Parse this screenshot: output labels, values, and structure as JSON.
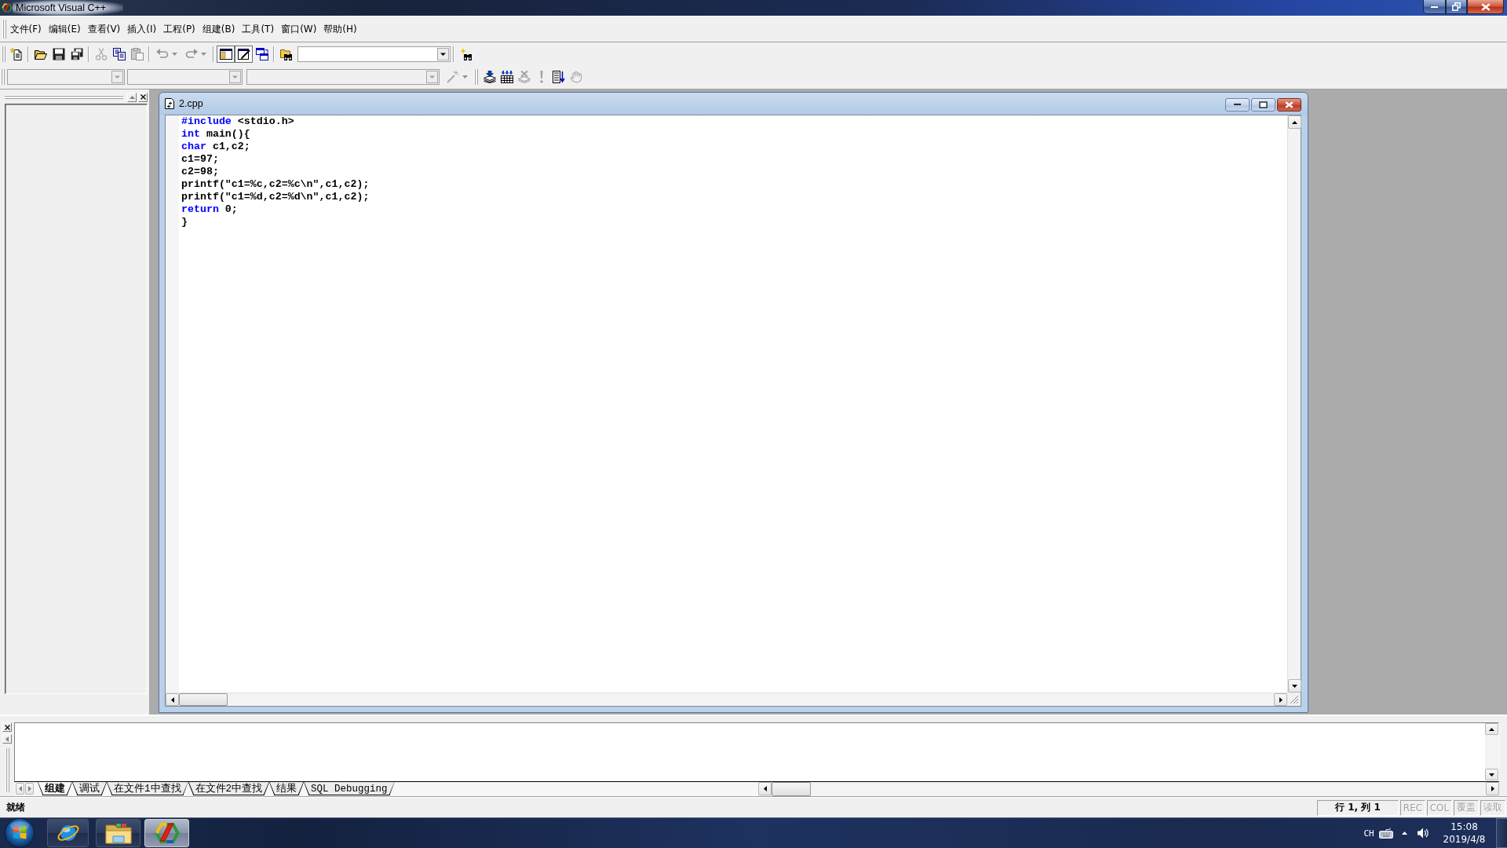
{
  "window": {
    "title": "Microsoft Visual C++"
  },
  "menu_bar": {
    "items": [
      {
        "label": "文件(F)"
      },
      {
        "label": "编辑(E)"
      },
      {
        "label": "查看(V)"
      },
      {
        "label": "插入(I)"
      },
      {
        "label": "工程(P)"
      },
      {
        "label": "组建(B)"
      },
      {
        "label": "工具(T)"
      },
      {
        "label": "窗口(W)"
      },
      {
        "label": "帮助(H)"
      }
    ]
  },
  "standard_toolbar": {
    "buttons": [
      {
        "disabled": false
      },
      {
        "disabled": false
      },
      {
        "disabled": false
      },
      {
        "disabled": false
      },
      {
        "disabled": true
      },
      {
        "disabled": false
      },
      {
        "disabled": true
      },
      {
        "disabled": true
      },
      {
        "disabled": true
      },
      {
        "disabled": false
      },
      {
        "disabled": false
      },
      {
        "disabled": false
      }
    ],
    "toggles": [
      {
        "checked": true
      },
      {
        "checked": true
      }
    ],
    "combos": [
      {
        "disabled": false
      }
    ]
  },
  "build_toolbar": {
    "combos": [
      {
        "disabled": true
      },
      {
        "disabled": true
      },
      {
        "disabled": true
      }
    ],
    "buttons": [
      {
        "disabled": true
      },
      {
        "disabled": false
      },
      {
        "disabled": false
      },
      {
        "disabled": true
      },
      {
        "disabled": true
      },
      {
        "disabled": false
      },
      {
        "disabled": true
      }
    ]
  },
  "editor": {
    "title": "2.cpp",
    "lines": [
      {
        "tokens": [
          {
            "text": "#include",
            "kind": "keyword"
          },
          {
            "text": " <stdio.h>",
            "kind": "plain"
          }
        ]
      },
      {
        "tokens": [
          {
            "text": "int",
            "kind": "keyword"
          },
          {
            "text": " main(){",
            "kind": "plain"
          }
        ]
      },
      {
        "tokens": [
          {
            "text": "char",
            "kind": "keyword"
          },
          {
            "text": " c1,c2;",
            "kind": "plain"
          }
        ]
      },
      {
        "tokens": [
          {
            "text": "c1=97;",
            "kind": "plain"
          }
        ]
      },
      {
        "tokens": [
          {
            "text": "c2=98;",
            "kind": "plain"
          }
        ]
      },
      {
        "tokens": [
          {
            "text": "printf(\"c1=%c,c2=%c\\n\",c1,c2);",
            "kind": "plain"
          }
        ]
      },
      {
        "tokens": [
          {
            "text": "printf(\"c1=%d,c2=%d\\n\",c1,c2);",
            "kind": "plain"
          }
        ]
      },
      {
        "tokens": [
          {
            "text": "return",
            "kind": "keyword"
          },
          {
            "text": " 0;",
            "kind": "plain"
          }
        ]
      },
      {
        "tokens": [
          {
            "text": "}",
            "kind": "plain"
          }
        ]
      }
    ]
  },
  "output_panel": {
    "tabs": [
      {
        "label": "组建",
        "selected": true
      },
      {
        "label": "调试",
        "selected": false
      },
      {
        "label": "在文件1中查找",
        "selected": false
      },
      {
        "label": "在文件2中查找",
        "selected": false
      },
      {
        "label": "结果",
        "selected": false
      },
      {
        "label": "SQL Debugging",
        "selected": false
      }
    ]
  },
  "status_bar": {
    "message": "就绪",
    "panes": [
      {
        "text": "行 1, 列 1",
        "disabled": false
      },
      {
        "text": "REC",
        "disabled": true
      },
      {
        "text": "COL",
        "disabled": true
      },
      {
        "text": "覆盖",
        "disabled": true
      },
      {
        "text": "读取",
        "disabled": true
      }
    ]
  },
  "taskbar": {
    "apps": [
      {
        "selected": false
      },
      {
        "selected": false
      },
      {
        "selected": true
      }
    ],
    "language": "CH",
    "time": "15:08",
    "date": "2019/4/8"
  }
}
